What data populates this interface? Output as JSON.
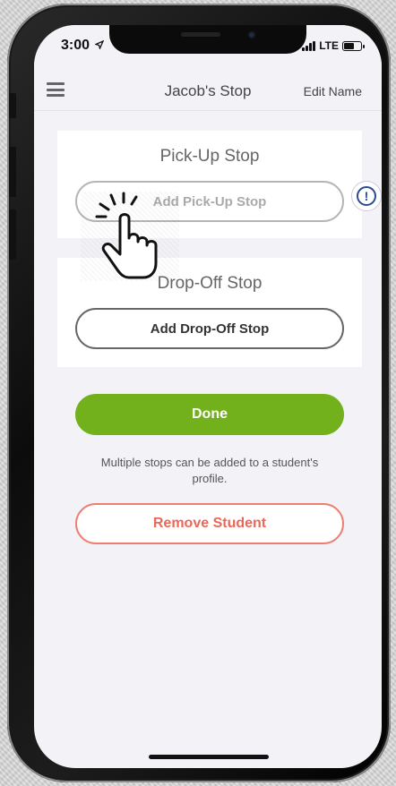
{
  "status_bar": {
    "time": "3:00",
    "location_icon": "location-arrow-icon",
    "network": "LTE",
    "signal_icon": "signal-bars-icon",
    "battery_icon": "battery-icon"
  },
  "nav": {
    "menu_icon": "hamburger-menu-icon",
    "title": "Jacob's Stop",
    "edit_label": "Edit Name"
  },
  "pickup": {
    "title": "Pick-Up Stop",
    "button_label": "Add Pick-Up Stop",
    "info_icon": "info-exclamation-icon",
    "info_glyph": "!"
  },
  "dropoff": {
    "title": "Drop-Off Stop",
    "button_label": "Add Drop-Off Stop"
  },
  "actions": {
    "done_label": "Done",
    "helper_text": "Multiple stops can be added to a student's profile.",
    "remove_label": "Remove Student"
  },
  "overlay": {
    "pointer_icon": "tap-hand-pointer-icon"
  },
  "colors": {
    "done": "#73b11c",
    "remove": "#e9685a",
    "info": "#2b4c8c"
  }
}
